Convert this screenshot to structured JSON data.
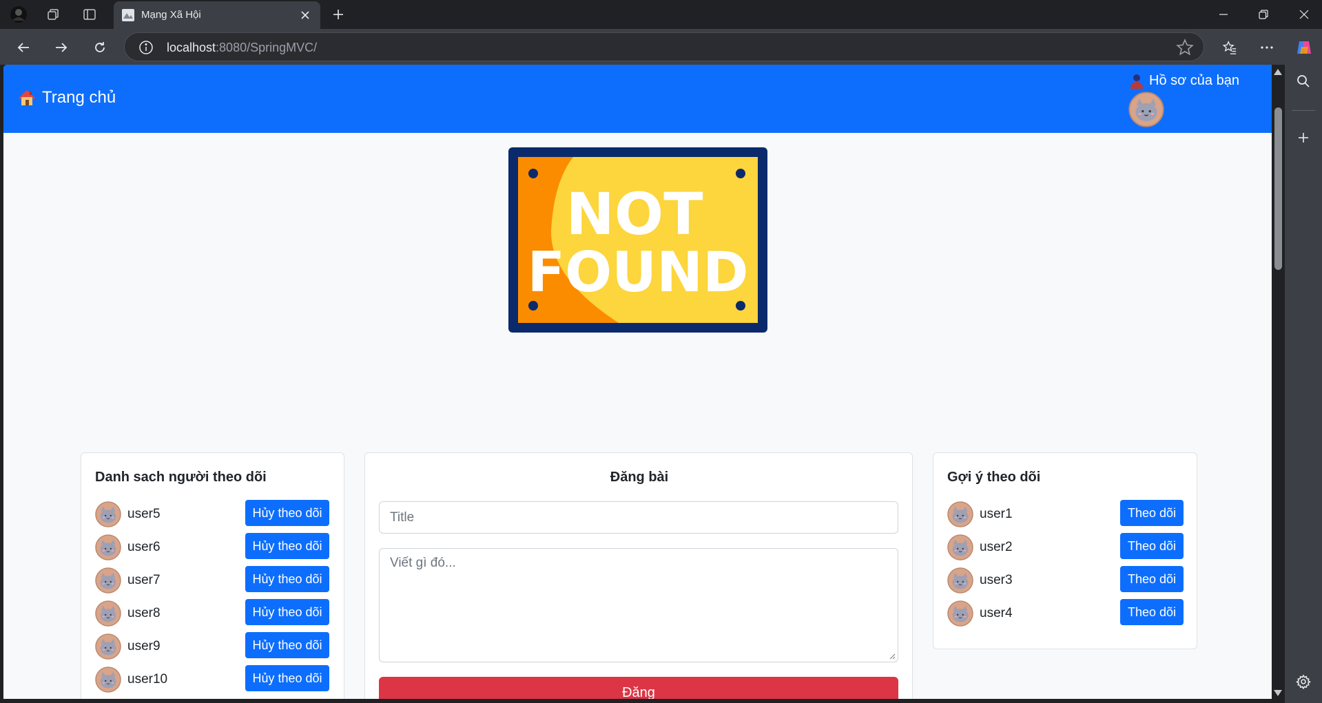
{
  "browser": {
    "tab_title": "Mạng Xã Hội",
    "url_host": "localhost",
    "url_rest": ":8080/SpringMVC/"
  },
  "navbar": {
    "brand_label": "Trang chủ",
    "profile_label": "Hồ sơ của bạn"
  },
  "banner": {
    "line1": "NOT",
    "line2": "FOUND"
  },
  "following": {
    "title": "Danh sach người theo dõi",
    "button_label": "Hủy theo dõi",
    "users": [
      "user5",
      "user6",
      "user7",
      "user8",
      "user9",
      "user10"
    ]
  },
  "post": {
    "title": "Đăng bài",
    "title_placeholder": "Title",
    "body_placeholder": "Viết gì đó...",
    "submit_label": "Đăng"
  },
  "suggestions": {
    "title": "Gợi ý theo dõi",
    "button_label": "Theo dõi",
    "users": [
      "user1",
      "user2",
      "user3",
      "user4"
    ]
  },
  "colors": {
    "primary": "#0d6efd",
    "danger": "#dc3545",
    "page_bg": "#f8f9fa"
  }
}
